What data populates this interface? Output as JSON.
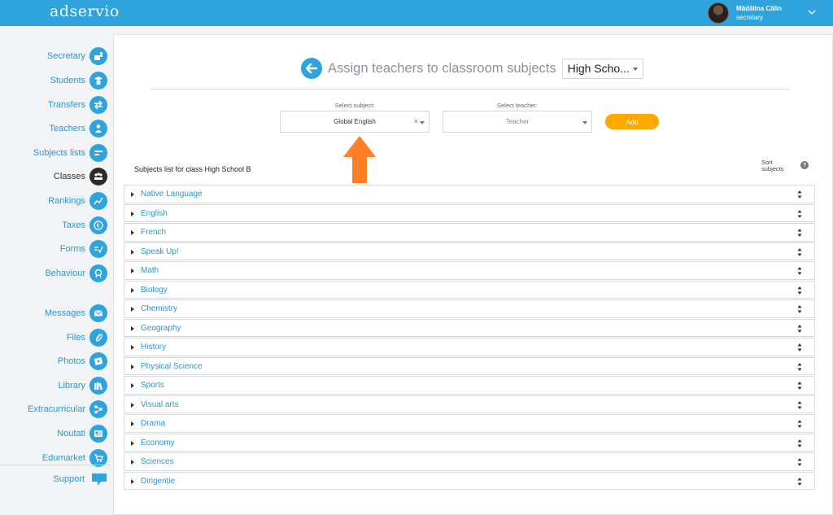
{
  "app": {
    "logo": "adservio",
    "user": {
      "name": "Mădălina Călin",
      "role": "secretary"
    }
  },
  "sidebar": {
    "items": [
      {
        "label": "Secretary",
        "icon": "secretary-icon"
      },
      {
        "label": "Students",
        "icon": "graduate-icon"
      },
      {
        "label": "Transfers",
        "icon": "transfer-arrows-icon"
      },
      {
        "label": "Teachers",
        "icon": "teacher-icon"
      },
      {
        "label": "Subjects lists",
        "icon": "list-bars-icon"
      },
      {
        "label": "Classes",
        "icon": "classroom-icon",
        "active": true
      },
      {
        "label": "Rankings",
        "icon": "trend-line-icon"
      },
      {
        "label": "Taxes",
        "icon": "euro-icon"
      },
      {
        "label": "Forms",
        "icon": "form-check-icon"
      },
      {
        "label": "Behaviour",
        "icon": "award-icon"
      },
      {
        "label": "Messages",
        "icon": "envelope-icon"
      },
      {
        "label": "Files",
        "icon": "paperclip-icon"
      },
      {
        "label": "Photos",
        "icon": "photo-icon"
      },
      {
        "label": "Library",
        "icon": "books-icon"
      },
      {
        "label": "Extracurricular",
        "icon": "network-icon"
      },
      {
        "label": "Noutati",
        "icon": "news-icon"
      },
      {
        "label": "Edumarket",
        "icon": "cart-icon"
      }
    ],
    "support": {
      "label": "Support",
      "icon": "chat-bubble-icon"
    }
  },
  "page": {
    "title": "Assign teachers to classroom subjects",
    "class_select": "High Scho..."
  },
  "form": {
    "subject_label": "Select subject:",
    "subject_value": "Global English",
    "subject_clear": "×",
    "teacher_label": "Select teacher:",
    "teacher_placeholder": "Teacher",
    "add_label": "Add"
  },
  "list": {
    "header": "Subjects list for class High School B",
    "sort_label_1": "Sort",
    "sort_label_2": "subjects",
    "help": "?",
    "subjects": [
      "Native Language",
      "English",
      "French",
      "Speak Up!",
      "Math",
      "Biology",
      "Chemistry",
      "Geography",
      "History",
      "Physical Science",
      "Sports",
      "Visual arts",
      "Drama",
      "Economy",
      "Sciences",
      "Dirigenție"
    ]
  },
  "colors": {
    "brand_blue": "#2ea3dc",
    "accent_orange": "#ffa800",
    "annotation_arrow": "#ff7f27"
  }
}
